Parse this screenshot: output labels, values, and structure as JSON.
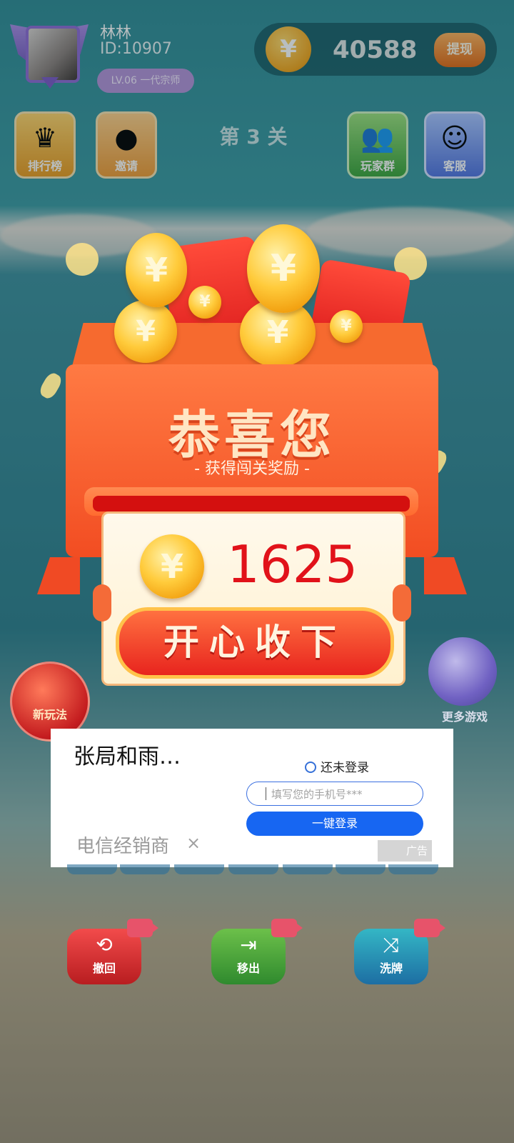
{
  "user": {
    "name": "林林",
    "id": "ID:10907",
    "level_badge": "LV.06 一代宗师"
  },
  "balance": {
    "amount": "40588",
    "withdraw_label": "提现",
    "currency_symbol": "¥"
  },
  "top_tiles": [
    {
      "label": "排行榜",
      "icon": "crown-icon"
    },
    {
      "label": "邀请",
      "icon": "fruit-icon"
    },
    {
      "label": "玩家群",
      "icon": "group-icon"
    },
    {
      "label": "客服",
      "icon": "robot-icon"
    }
  ],
  "level_label": "第 3 关",
  "reward_modal": {
    "title": "恭喜您",
    "subtitle": "- 获得闯关奖励 -",
    "amount": "1625",
    "accept_label": "开心收下",
    "coin_symbol": "¥"
  },
  "side_left": {
    "label": "新玩法"
  },
  "side_right": {
    "label": "更多游戏"
  },
  "ad": {
    "title": "张局和雨…",
    "login_status": "还未登录",
    "phone_placeholder": "填写您的手机号***",
    "login_button": "一键登录",
    "dealer": "电信经销商",
    "close": "×",
    "badge": "广告"
  },
  "tools": [
    {
      "label": "撤回",
      "icon": "undo-icon",
      "glyph": "⟲"
    },
    {
      "label": "移出",
      "icon": "move-out-icon",
      "glyph": "⇥"
    },
    {
      "label": "洗牌",
      "icon": "shuffle-icon",
      "glyph": "⤨"
    }
  ],
  "colors": {
    "accent_red": "#e1121a",
    "button_blue": "#1766f2",
    "coin_gold": "#ffcb3b"
  }
}
